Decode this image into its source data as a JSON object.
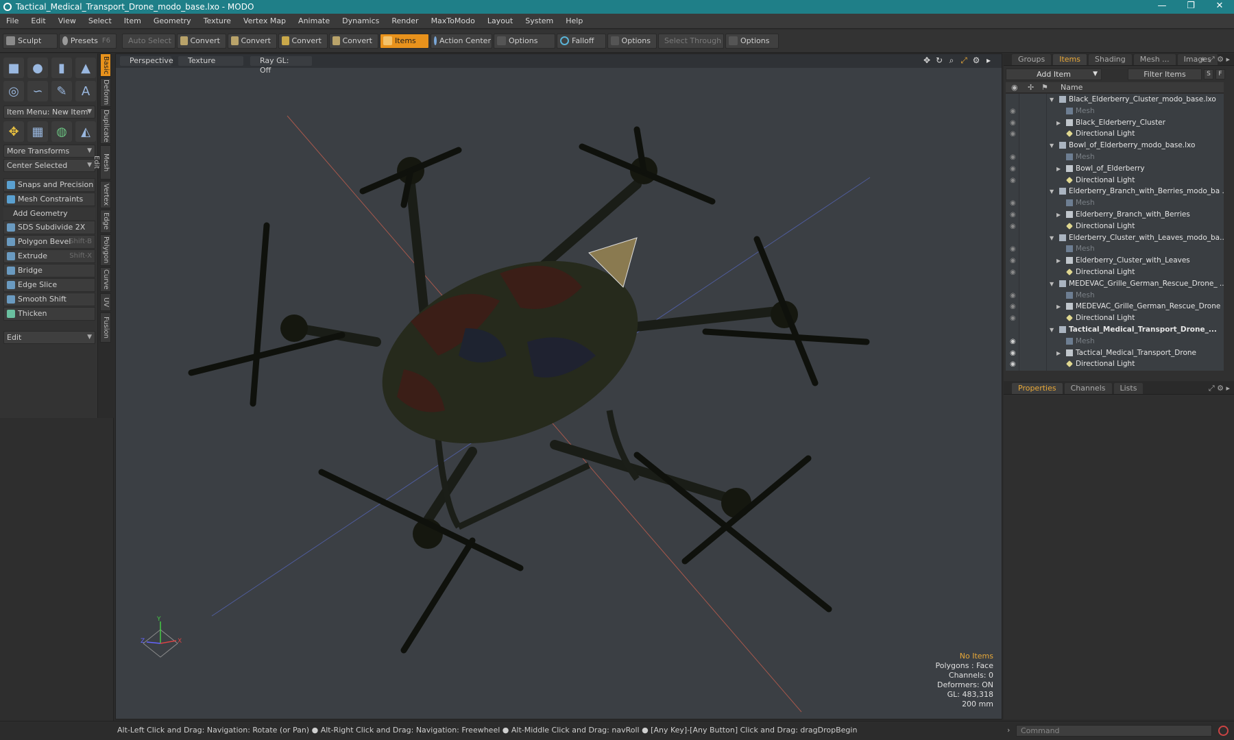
{
  "window": {
    "title": "Tactical_Medical_Transport_Drone_modo_base.lxo - MODO",
    "controls": [
      "—",
      "❐",
      "✕"
    ]
  },
  "menu": [
    "File",
    "Edit",
    "View",
    "Select",
    "Item",
    "Geometry",
    "Texture",
    "Vertex Map",
    "Animate",
    "Dynamics",
    "Render",
    "MaxToModo",
    "Layout",
    "System",
    "Help"
  ],
  "toolbar": {
    "sculpt": "Sculpt",
    "presets": "Presets",
    "presets_key": "F6",
    "auto_select": "Auto Select",
    "convert": "Convert",
    "items": "Items",
    "action_center": "Action Center",
    "options": "Options",
    "falloff": "Falloff",
    "select_through": "Select Through"
  },
  "left_panel": {
    "item_menu": "Item Menu: New Item",
    "more_transforms": "More Transforms",
    "center_selected": "Center Selected",
    "snaps": "Snaps and Precision",
    "mesh_constraints": "Mesh Constraints",
    "add_geometry": "Add Geometry",
    "tools": [
      {
        "label": "SDS Subdivide 2X",
        "key": ""
      },
      {
        "label": "Polygon Bevel",
        "key": "Shift-B"
      },
      {
        "label": "Extrude",
        "key": "Shift-X"
      },
      {
        "label": "Bridge",
        "key": ""
      },
      {
        "label": "Edge Slice",
        "key": ""
      },
      {
        "label": "Smooth Shift",
        "key": ""
      },
      {
        "label": "Thicken",
        "key": ""
      }
    ],
    "edit": "Edit"
  },
  "vertical_tabs": [
    "Basic",
    "Deform",
    "Duplicate",
    "Mesh Edit",
    "Vertex",
    "Edge",
    "Polygon",
    "Curve",
    "UV",
    "Fusion"
  ],
  "viewport": {
    "header": [
      "Perspective",
      "Texture",
      "Ray GL: Off"
    ],
    "stats": {
      "selection": "No Items",
      "polygons": "Polygons : Face",
      "channels": "Channels: 0",
      "deformers": "Deformers: ON",
      "gl": "GL: 483,318",
      "scale": "200 mm"
    },
    "axis": {
      "x": "X",
      "y": "Y",
      "z": "Z"
    }
  },
  "items_panel": {
    "tabs": [
      "Groups",
      "Items",
      "Shading",
      "Mesh ...",
      "Images"
    ],
    "add_item": "Add Item",
    "filter_items": "Filter Items",
    "s": "S",
    "f": "F",
    "col_name": "Name",
    "rows": [
      {
        "label": "Black_Elderberry_Cluster_modo_base.lxo",
        "level": 0,
        "type": "scene",
        "dim": false,
        "bold": false
      },
      {
        "label": "Mesh",
        "level": 1,
        "type": "mesh",
        "dim": true,
        "bold": false
      },
      {
        "label": "Black_Elderberry_Cluster",
        "level": 1,
        "type": "group",
        "dim": false,
        "bold": false
      },
      {
        "label": "Directional Light",
        "level": 1,
        "type": "light",
        "dim": false,
        "bold": false
      },
      {
        "label": "Bowl_of_Elderberry_modo_base.lxo",
        "level": 0,
        "type": "scene",
        "dim": false,
        "bold": false
      },
      {
        "label": "Mesh",
        "level": 1,
        "type": "mesh",
        "dim": true,
        "bold": false
      },
      {
        "label": "Bowl_of_Elderberry",
        "level": 1,
        "type": "group",
        "dim": false,
        "bold": false
      },
      {
        "label": "Directional Light",
        "level": 1,
        "type": "light",
        "dim": false,
        "bold": false
      },
      {
        "label": "Elderberry_Branch_with_Berries_modo_ba ...",
        "level": 0,
        "type": "scene",
        "dim": false,
        "bold": false
      },
      {
        "label": "Mesh",
        "level": 1,
        "type": "mesh",
        "dim": true,
        "bold": false
      },
      {
        "label": "Elderberry_Branch_with_Berries",
        "level": 1,
        "type": "group",
        "dim": false,
        "bold": false
      },
      {
        "label": "Directional Light",
        "level": 1,
        "type": "light",
        "dim": false,
        "bold": false
      },
      {
        "label": "Elderberry_Cluster_with_Leaves_modo_ba...",
        "level": 0,
        "type": "scene",
        "dim": false,
        "bold": false
      },
      {
        "label": "Mesh",
        "level": 1,
        "type": "mesh",
        "dim": true,
        "bold": false
      },
      {
        "label": "Elderberry_Cluster_with_Leaves",
        "level": 1,
        "type": "group",
        "dim": false,
        "bold": false
      },
      {
        "label": "Directional Light",
        "level": 1,
        "type": "light",
        "dim": false,
        "bold": false
      },
      {
        "label": "MEDEVAC_Grille_German_Rescue_Drone_ ...",
        "level": 0,
        "type": "scene",
        "dim": false,
        "bold": false
      },
      {
        "label": "Mesh",
        "level": 1,
        "type": "mesh",
        "dim": true,
        "bold": false
      },
      {
        "label": "MEDEVAC_Grille_German_Rescue_Drone",
        "level": 1,
        "type": "group",
        "dim": false,
        "bold": false
      },
      {
        "label": "Directional Light",
        "level": 1,
        "type": "light",
        "dim": false,
        "bold": false
      },
      {
        "label": "Tactical_Medical_Transport_Drone_...",
        "level": 0,
        "type": "scene",
        "dim": false,
        "bold": true
      },
      {
        "label": "Mesh",
        "level": 1,
        "type": "mesh",
        "dim": true,
        "bold": false
      },
      {
        "label": "Tactical_Medical_Transport_Drone",
        "level": 1,
        "type": "group",
        "dim": false,
        "bold": false
      },
      {
        "label": "Directional Light",
        "level": 1,
        "type": "light",
        "dim": false,
        "bold": false
      }
    ]
  },
  "props_panel": {
    "tabs": [
      "Properties",
      "Channels",
      "Lists"
    ]
  },
  "command": {
    "placeholder": "Command"
  },
  "status": "Alt-Left Click and Drag: Navigation: Rotate (or Pan) ● Alt-Right Click and Drag: Navigation: Freewheel ● Alt-Middle Click and Drag: navRoll ● [Any Key]-[Any Button] Click and Drag: dragDropBegin",
  "colors": {
    "accent": "#e8921c",
    "titlebar": "#1f7f88",
    "viewport_bg": "#3b3f44"
  }
}
